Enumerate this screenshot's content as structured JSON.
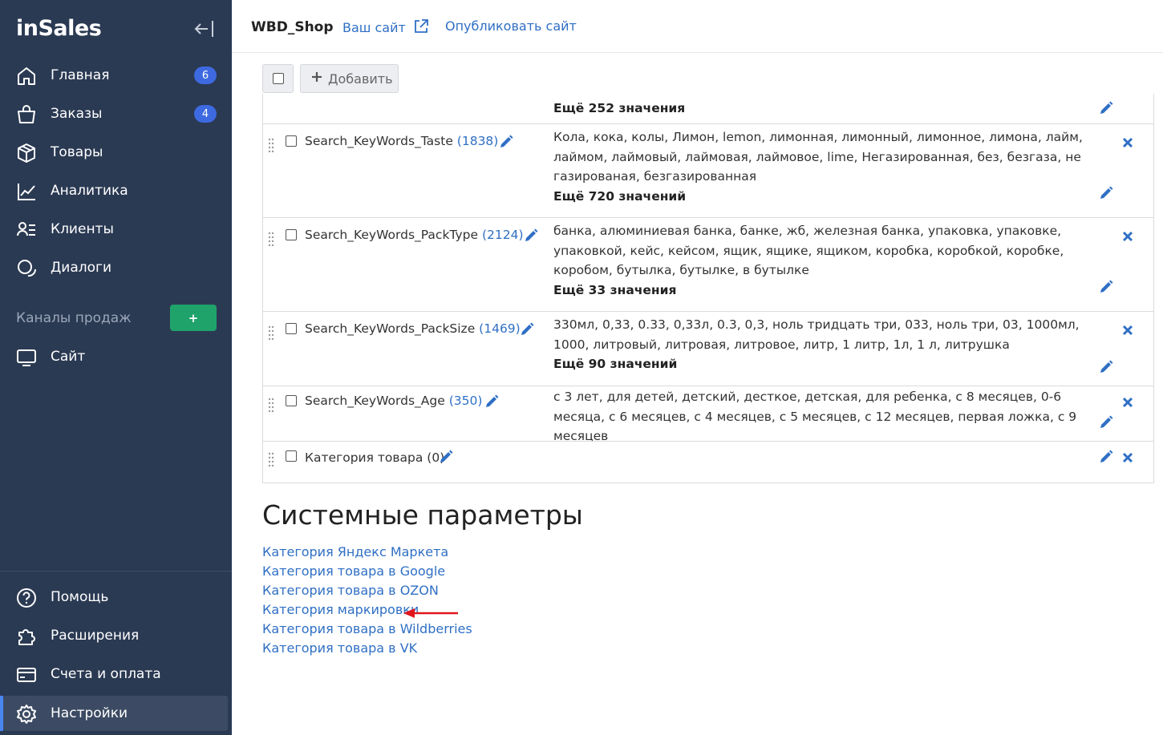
{
  "app": {
    "logo": "inSales"
  },
  "sidebar": {
    "nav": [
      {
        "label": "Главная",
        "badge": "6",
        "icon": "home-icon"
      },
      {
        "label": "Заказы",
        "badge": "4",
        "icon": "bag-icon"
      },
      {
        "label": "Товары",
        "icon": "box-icon"
      },
      {
        "label": "Аналитика",
        "icon": "chart-icon"
      },
      {
        "label": "Клиенты",
        "icon": "clients-icon"
      },
      {
        "label": "Диалоги",
        "icon": "chat-icon"
      }
    ],
    "channels": {
      "label": "Каналы продаж",
      "add": "+"
    },
    "site": {
      "label": "Сайт",
      "icon": "monitor-icon"
    },
    "bottom": [
      {
        "label": "Помощь",
        "icon": "help-icon"
      },
      {
        "label": "Расширения",
        "icon": "puzzle-icon"
      },
      {
        "label": "Счета и оплата",
        "icon": "card-icon"
      },
      {
        "label": "Настройки",
        "icon": "gear-icon"
      }
    ],
    "accent": "#2b3a53"
  },
  "topbar": {
    "shop": "WBD_Shop",
    "your_site": "Ваш сайт",
    "publish": "Опубликовать сайт"
  },
  "toolbar": {
    "add_label": "Добавить"
  },
  "first_row_more": "Ещё 252 значения",
  "params": [
    {
      "name": "Search_KeyWords_Taste",
      "count": "(1838)",
      "values": "Кола, кока, колы, Лимон, lemon, лимонная, лимонный, лимонное, лимона, лайм, лаймом, лаймовый, лаймовая, лаймовое, lime, Негазированная, без, безгаза, не газированая, безгазированная",
      "more": "Ещё 720 значений"
    },
    {
      "name": "Search_KeyWords_PackType",
      "count": "(2124)",
      "values": "банка, алюминиевая банка, банке, жб, железная банка, упаковка, упаковке, упаковкой, кейс, кейсом, ящик, ящике, ящиком, коробка, коробкой, коробке, коробом, бутылка, бутылке, в бутылке",
      "more": "Ещё 33 значения"
    },
    {
      "name": "Search_KeyWords_PackSize",
      "count": "(1469)",
      "values": "330мл, 0,33, 0.33, 0,33л, 0.3, 0,3, ноль тридцать три, 033, ноль три, 03, 1000мл, 1000, литровый, литровая, литровое, литр, 1 литр, 1л, 1 л, литрушка",
      "more": "Ещё 90 значений"
    },
    {
      "name": "Search_KeyWords_Age",
      "count": "(350)",
      "values": "с 3 лет, для детей, детский, десткое, детская, для ребенка, с 8 месяцев, 0-6 месяца, с 6 месяцев, с 4 месяцев, с 5 месяцев, с 12 месяцев, первая ложка, с 9 месяцев",
      "more": ""
    },
    {
      "name": "Категория товара",
      "count": "(0)",
      "values": "",
      "more": ""
    }
  ],
  "system": {
    "title": "Системные параметры",
    "links": [
      "Категория Яндекс Маркета",
      "Категория товара в Google",
      "Категория товара в OZON",
      "Категория маркировки",
      "Категория товара в Wildberries",
      "Категория товара в VK"
    ]
  },
  "colors": {
    "link": "#2f6fc4",
    "arrow": "#e0161b",
    "badge": "#3d6ae0",
    "add_channel": "#1fa36b"
  }
}
